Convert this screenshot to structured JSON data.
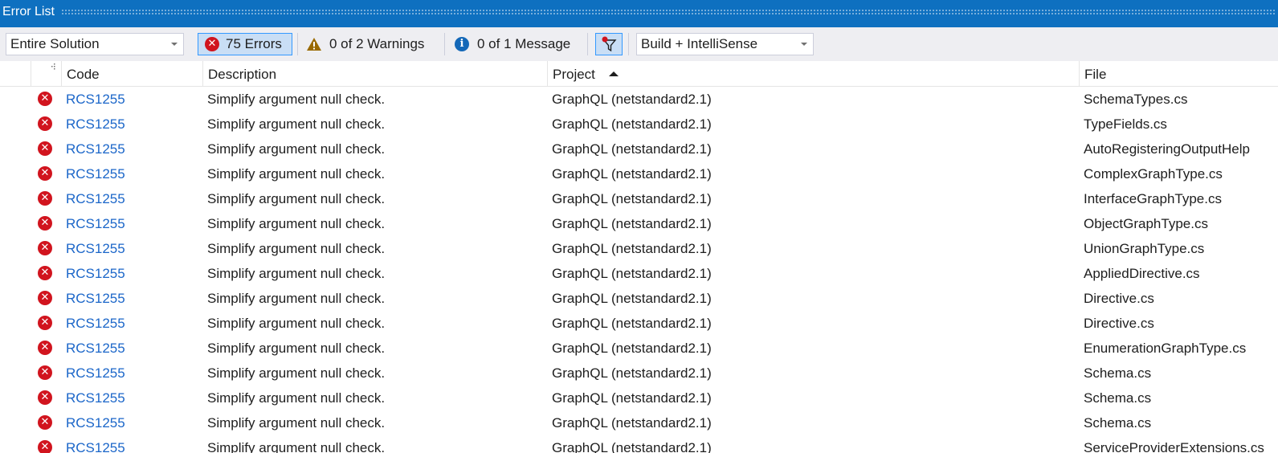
{
  "window": {
    "title": "Error List"
  },
  "toolbar": {
    "scope": "Entire Solution",
    "errors_label": "75 Errors",
    "warnings_label": "0 of 2 Warnings",
    "messages_label": "0 of 1 Message",
    "source": "Build + IntelliSense"
  },
  "columns": {
    "code": "Code",
    "description": "Description",
    "project": "Project",
    "file": "File"
  },
  "rows": [
    {
      "code": "RCS1255",
      "description": "Simplify argument null check.",
      "project": "GraphQL (netstandard2.1)",
      "file": "SchemaTypes.cs"
    },
    {
      "code": "RCS1255",
      "description": "Simplify argument null check.",
      "project": "GraphQL (netstandard2.1)",
      "file": "TypeFields.cs"
    },
    {
      "code": "RCS1255",
      "description": "Simplify argument null check.",
      "project": "GraphQL (netstandard2.1)",
      "file": "AutoRegisteringOutputHelp"
    },
    {
      "code": "RCS1255",
      "description": "Simplify argument null check.",
      "project": "GraphQL (netstandard2.1)",
      "file": "ComplexGraphType.cs"
    },
    {
      "code": "RCS1255",
      "description": "Simplify argument null check.",
      "project": "GraphQL (netstandard2.1)",
      "file": "InterfaceGraphType.cs"
    },
    {
      "code": "RCS1255",
      "description": "Simplify argument null check.",
      "project": "GraphQL (netstandard2.1)",
      "file": "ObjectGraphType.cs"
    },
    {
      "code": "RCS1255",
      "description": "Simplify argument null check.",
      "project": "GraphQL (netstandard2.1)",
      "file": "UnionGraphType.cs"
    },
    {
      "code": "RCS1255",
      "description": "Simplify argument null check.",
      "project": "GraphQL (netstandard2.1)",
      "file": "AppliedDirective.cs"
    },
    {
      "code": "RCS1255",
      "description": "Simplify argument null check.",
      "project": "GraphQL (netstandard2.1)",
      "file": "Directive.cs"
    },
    {
      "code": "RCS1255",
      "description": "Simplify argument null check.",
      "project": "GraphQL (netstandard2.1)",
      "file": "Directive.cs"
    },
    {
      "code": "RCS1255",
      "description": "Simplify argument null check.",
      "project": "GraphQL (netstandard2.1)",
      "file": "EnumerationGraphType.cs"
    },
    {
      "code": "RCS1255",
      "description": "Simplify argument null check.",
      "project": "GraphQL (netstandard2.1)",
      "file": "Schema.cs"
    },
    {
      "code": "RCS1255",
      "description": "Simplify argument null check.",
      "project": "GraphQL (netstandard2.1)",
      "file": "Schema.cs"
    },
    {
      "code": "RCS1255",
      "description": "Simplify argument null check.",
      "project": "GraphQL (netstandard2.1)",
      "file": "Schema.cs"
    },
    {
      "code": "RCS1255",
      "description": "Simplify argument null check.",
      "project": "GraphQL (netstandard2.1)",
      "file": "ServiceProviderExtensions.cs"
    }
  ],
  "colors": {
    "accent": "#0e70c0",
    "error": "#d1141e",
    "info": "#1468b8",
    "warning": "#9a6a00",
    "link": "#1b66c9"
  }
}
